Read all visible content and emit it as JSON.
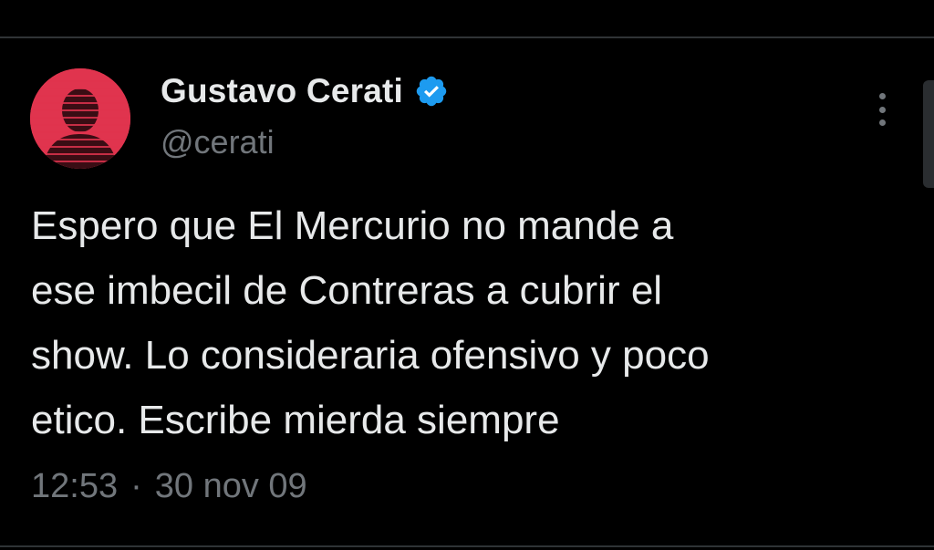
{
  "tweet": {
    "author": {
      "display_name": "Gustavo Cerati",
      "handle": "@cerati",
      "verified": true,
      "avatar_color": "#e0344e"
    },
    "text": "Espero que El Mercurio no mande a\nese imbecil de Contreras a cubrir el\nshow. Lo consideraria ofensivo y poco\netico. Escribe mierda siempre",
    "time": "12:53",
    "separator": "·",
    "date": "30 nov 09",
    "more_icon": "more-vertical-icon"
  },
  "colors": {
    "background": "#000000",
    "text_primary": "#e7e9ea",
    "text_secondary": "#71767b",
    "verified_badge": "#1d9bf0",
    "divider": "#2f3336"
  }
}
